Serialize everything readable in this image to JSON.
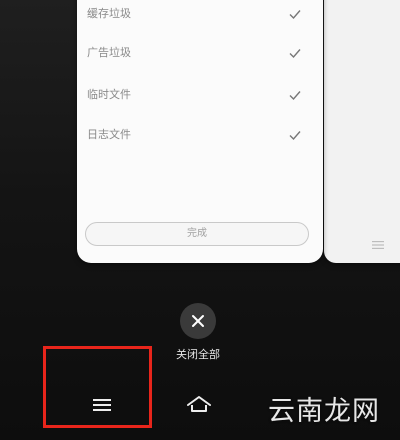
{
  "recents_card": {
    "items": [
      {
        "label": "缓存垃圾",
        "checked": true
      },
      {
        "label": "广告垃圾",
        "checked": true
      },
      {
        "label": "临时文件",
        "checked": true
      },
      {
        "label": "日志文件",
        "checked": true
      }
    ],
    "done_label": "完成"
  },
  "controls": {
    "close_all_label": "关闭全部"
  },
  "watermark": {
    "text": "云南龙网"
  },
  "colors": {
    "highlight": "#e8251b",
    "check": "#777777"
  },
  "icons": [
    "check-icon",
    "close-icon",
    "menu-icon",
    "home-icon"
  ]
}
